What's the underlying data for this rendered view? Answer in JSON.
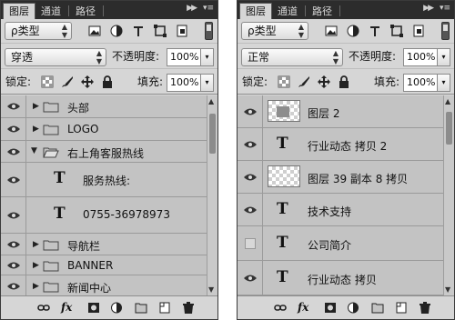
{
  "tabs": {
    "layers": "图层",
    "channels": "通道",
    "paths": "路径",
    "collapse": "▶▶",
    "menu": "▾≡"
  },
  "filter": {
    "type_label": "ρ类型",
    "arrows": "▲▼"
  },
  "options": {
    "opacity_label": "不透明度:",
    "lock_label": "锁定:",
    "fill_label": "填充:",
    "dropdown_arrow": "▾"
  },
  "left_panel": {
    "blend_mode": "穿透",
    "opacity": "100%",
    "fill": "100%",
    "layers": [
      {
        "kind": "group",
        "name": "头部",
        "visible": true,
        "open": false
      },
      {
        "kind": "group",
        "name": "LOGO",
        "visible": true,
        "open": false
      },
      {
        "kind": "group",
        "name": "右上角客服热线",
        "visible": true,
        "open": true
      },
      {
        "kind": "text",
        "name": "服务热线:",
        "visible": true,
        "indent": true
      },
      {
        "kind": "text",
        "name": "0755-36978973",
        "visible": true,
        "indent": true
      },
      {
        "kind": "group",
        "name": "导航栏",
        "visible": true,
        "open": false
      },
      {
        "kind": "group",
        "name": "BANNER",
        "visible": true,
        "open": false
      },
      {
        "kind": "group",
        "name": "新闻中心",
        "visible": true,
        "open": false
      }
    ]
  },
  "right_panel": {
    "blend_mode": "正常",
    "opacity": "100%",
    "fill": "100%",
    "layers": [
      {
        "kind": "image",
        "name": "图层 2",
        "visible": true,
        "thumb_content": true
      },
      {
        "kind": "text",
        "name": "行业动态 拷贝 2",
        "visible": true
      },
      {
        "kind": "image",
        "name": "图层 39 副本 8 拷贝",
        "visible": true,
        "thumb_content": false
      },
      {
        "kind": "text",
        "name": "技术支持",
        "visible": true
      },
      {
        "kind": "text",
        "name": "公司简介",
        "visible": false
      },
      {
        "kind": "text",
        "name": "行业动态 拷贝",
        "visible": true
      }
    ]
  },
  "footer": {
    "fx_label": "fx"
  }
}
